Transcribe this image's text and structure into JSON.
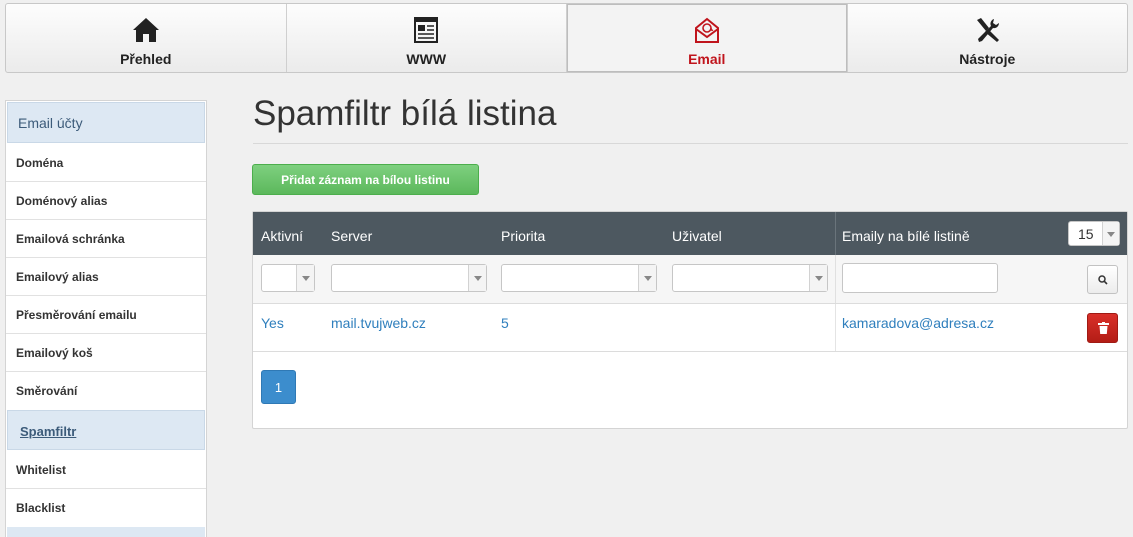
{
  "topnav": {
    "tabs": [
      {
        "label": "Přehled",
        "icon": "home-icon"
      },
      {
        "label": "WWW",
        "icon": "webpage-icon"
      },
      {
        "label": "Email",
        "icon": "email-icon",
        "active": true
      },
      {
        "label": "Nástroje",
        "icon": "tools-icon"
      }
    ]
  },
  "sidebar": {
    "section_title": "Email účty",
    "items": [
      {
        "label": "Doména"
      },
      {
        "label": "Doménový alias"
      },
      {
        "label": "Emailová schránka"
      },
      {
        "label": "Emailový alias"
      },
      {
        "label": "Přesměrování emailu"
      },
      {
        "label": "Emailový koš"
      },
      {
        "label": "Směrování"
      }
    ],
    "subsection_title": "Spamfiltr",
    "subitems": [
      {
        "label": "Whitelist"
      },
      {
        "label": "Blacklist"
      }
    ]
  },
  "main": {
    "title": "Spamfiltr bílá listina",
    "add_button": "Přidat záznam na bílou listinu",
    "grid": {
      "columns": [
        "Aktivní",
        "Server",
        "Priorita",
        "Uživatel",
        "Emaily na bílé listině"
      ],
      "page_size": "15",
      "rows": [
        {
          "active": "Yes",
          "server": "mail.tvujweb.cz",
          "priority": "5",
          "user": "",
          "email": "kamaradova@adresa.cz"
        }
      ],
      "current_page": "1"
    }
  },
  "colors": {
    "active_tab_label": "#c0141c",
    "grid_header": "#4d5860",
    "link": "#2f7fbd",
    "add_button": "#5cb85c",
    "delete_button": "#c9302c",
    "page_button": "#3c8dcd",
    "sidebar_section": "#dde8f3"
  }
}
